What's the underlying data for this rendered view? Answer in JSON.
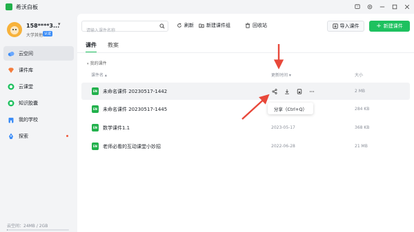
{
  "app": {
    "title": "希沃白板"
  },
  "user": {
    "name": "158****3...",
    "role": "大学其他",
    "badge": "认证"
  },
  "sidebar": {
    "items": [
      {
        "label": "云空间",
        "icon": "cloud-icon"
      },
      {
        "label": "课件库",
        "icon": "gem-icon"
      },
      {
        "label": "云课堂",
        "icon": "play-circle-icon"
      },
      {
        "label": "知识胶囊",
        "icon": "capsule-icon"
      },
      {
        "label": "我的学校",
        "icon": "school-icon"
      },
      {
        "label": "探索",
        "icon": "rocket-icon"
      }
    ],
    "storage": {
      "text": "云空间：24MB / 2GB",
      "fraction": 0.012
    }
  },
  "toolbar": {
    "search_placeholder": "请输入课件名称",
    "refresh_label": "刷新",
    "new_group_label": "新建课件组",
    "recycle_label": "回收站",
    "import_label": "导入课件",
    "new_label": "新建课件"
  },
  "tabs": [
    {
      "label": "课件"
    },
    {
      "label": "教案"
    }
  ],
  "breadcrumb": "我的课件",
  "columns": {
    "name": "课件名",
    "time": "更新时间",
    "size": "大小"
  },
  "files": [
    {
      "name": "未命名课件 20230517-1442",
      "time": "",
      "size": "2 MB",
      "type": "EN"
    },
    {
      "name": "未命名课件 20230517-1445",
      "time": "",
      "size": "284 KB",
      "type": "EN"
    },
    {
      "name": "数学课件1.1",
      "time": "2023-05-17",
      "size": "368 KB",
      "type": "EN"
    },
    {
      "name": "老师必看的互动课堂小妙招",
      "time": "2022-06-28",
      "size": "21 MB",
      "type": "EN"
    }
  ],
  "tooltip": "分享（Ctrl+Q）",
  "colors": {
    "accent": "#1ec15f",
    "annotation": "#e8483a"
  }
}
